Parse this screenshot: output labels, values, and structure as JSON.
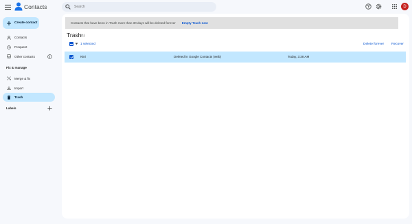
{
  "app": {
    "name": "Contacts",
    "avatar_initial": "D",
    "avatar_color": "#c5221f"
  },
  "search": {
    "placeholder": "Search"
  },
  "header_icons": [
    "menu-icon",
    "help-icon",
    "settings-icon",
    "apps-grid-icon"
  ],
  "sidebar": {
    "create_label": "Create contact",
    "items": [
      {
        "label": "Contacts",
        "icon": "person-icon"
      },
      {
        "label": "Frequent",
        "icon": "history-icon"
      },
      {
        "label": "Other contacts",
        "icon": "inbox-icon"
      }
    ],
    "fix_section": "Fix & manage",
    "fix_items": [
      {
        "label": "Merge & fix",
        "icon": "merge-icon"
      },
      {
        "label": "Import",
        "icon": "import-icon"
      },
      {
        "label": "Trash",
        "icon": "trash-icon",
        "active": true
      }
    ],
    "labels_section": "Labels"
  },
  "banner": {
    "message": "Contacts that have been in Trash more than 30 days will be deleted forever",
    "link": "Empty Trash now"
  },
  "page": {
    "title": "Trash",
    "count": "(1)"
  },
  "toolbar": {
    "selected": "1 selected",
    "delete_forever": "Delete forever",
    "recover": "Recover"
  },
  "rows": [
    {
      "name": "Nini",
      "source": "Deleted in Google Contacts (web)",
      "time": "Today, 3:38 AM",
      "checked": true
    }
  ],
  "colors": {
    "accent": "#0b57d0",
    "selected_bg": "#c2e7ff",
    "banner_bg": "#e0e0e0",
    "page_bg": "#f6f8fc"
  }
}
